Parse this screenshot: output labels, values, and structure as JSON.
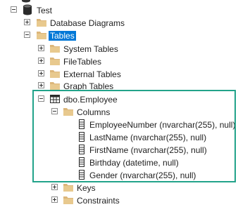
{
  "tree": {
    "root": {
      "label": "Test",
      "icon": "database-icon"
    },
    "nodes": [
      {
        "label": "Database Diagrams",
        "icon": "folder-icon"
      },
      {
        "label": "Tables",
        "icon": "folder-icon",
        "selected": true
      },
      {
        "label": "System Tables",
        "icon": "folder-icon"
      },
      {
        "label": "FileTables",
        "icon": "folder-icon"
      },
      {
        "label": "External Tables",
        "icon": "folder-icon"
      },
      {
        "label": "Graph Tables",
        "icon": "folder-icon"
      },
      {
        "label": "dbo.Employee",
        "icon": "table-icon"
      },
      {
        "label": "Columns",
        "icon": "folder-icon"
      }
    ],
    "columns": [
      {
        "label": "EmployeeNumber (nvarchar(255), null)",
        "icon": "column-icon"
      },
      {
        "label": "LastName (nvarchar(255), null)",
        "icon": "column-icon"
      },
      {
        "label": "FirstName (nvarchar(255), null)",
        "icon": "column-icon"
      },
      {
        "label": "Birthday (datetime, null)",
        "icon": "column-icon"
      },
      {
        "label": "Gender (nvarchar(255), null)",
        "icon": "column-icon"
      }
    ],
    "after": [
      {
        "label": "Keys",
        "icon": "folder-icon"
      },
      {
        "label": "Constraints",
        "icon": "folder-icon"
      }
    ]
  },
  "colors": {
    "selection": "#0078d7",
    "highlight_border": "#22a38a",
    "folder": "#dcb67a"
  }
}
